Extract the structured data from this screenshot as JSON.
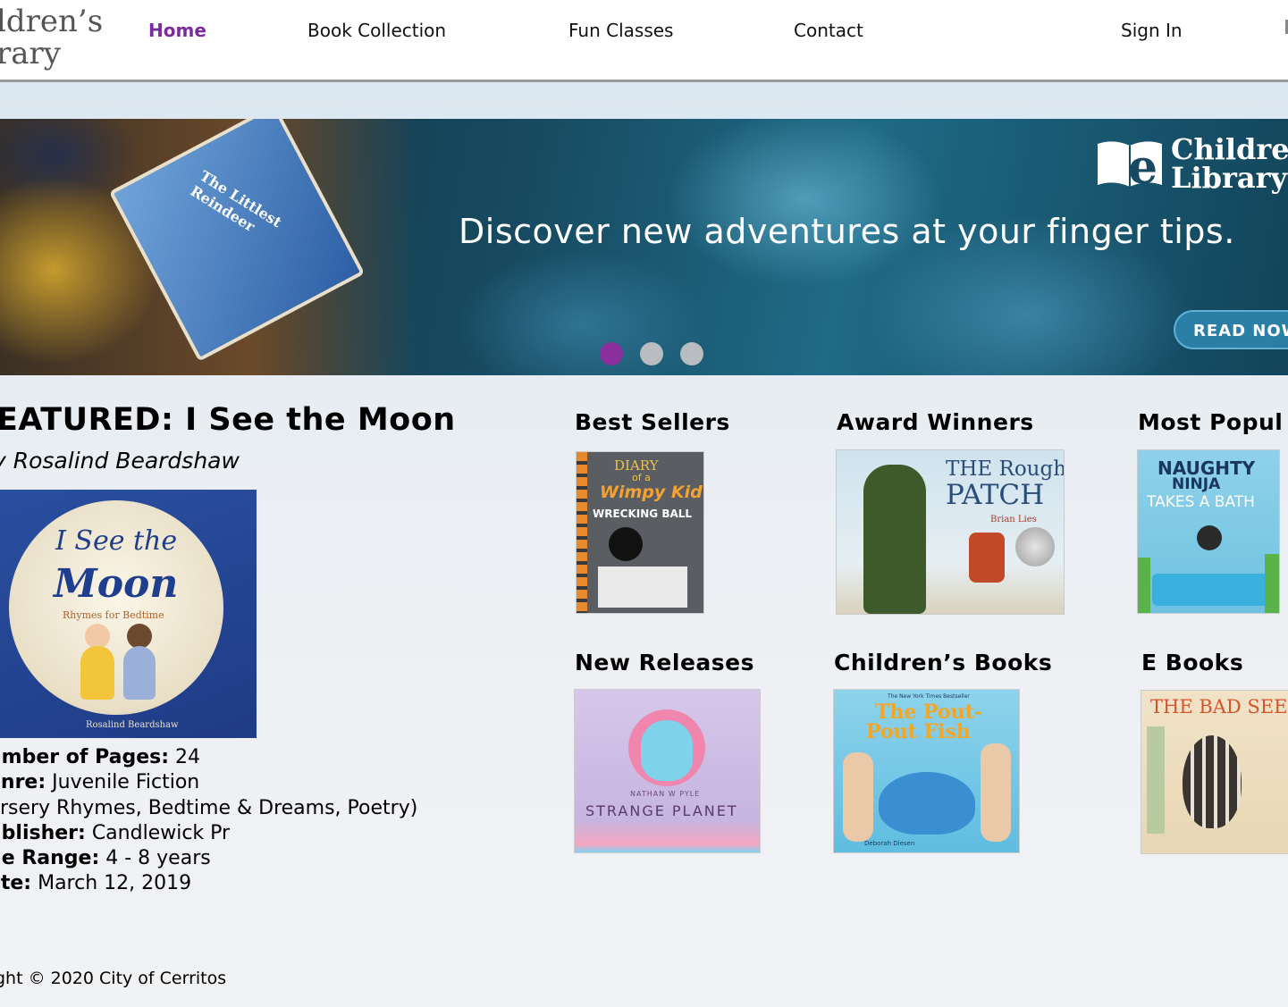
{
  "header": {
    "logo_line1": "ldren’s",
    "logo_line2": "rary",
    "nav": {
      "home": "Home",
      "collection": "Book Collection",
      "classes": "Fun Classes",
      "contact": "Contact",
      "signin": "Sign In"
    }
  },
  "hero": {
    "tagline": "Discover new adventures at your finger tips.",
    "brand_line1": "Childre",
    "brand_line2": "Library",
    "read_now": "READ NOW",
    "book_title": "The Littlest Reindeer",
    "active_slide": 1,
    "slide_count": 3
  },
  "featured": {
    "title": "EATURED: I See the Moon",
    "author": "y Rosalind Beardshaw",
    "cover": {
      "title_line1": "I See the",
      "title_line2": "Moon",
      "subtitle": "Rhymes for Bedtime",
      "author": "Rosalind Beardshaw"
    },
    "details": {
      "pages_label": "umber of Pages:",
      "pages_value": " 24",
      "genre_label": "enre:",
      "genre_value": " Juvenile Fiction",
      "genre_cont": "ursery Rhymes, Bedtime & Dreams, Poetry)",
      "publisher_label": "ublisher:",
      "publisher_value": " Candlewick Pr",
      "age_label": "ge Range:",
      "age_value": " 4 - 8 years",
      "date_label": "ate:",
      "date_value": " March 12, 2019"
    }
  },
  "categories": {
    "best_sellers": {
      "title": "Best Sellers",
      "cover_line1": "DIARY",
      "cover_line2": "of a",
      "cover_line3": "Wimpy Kid",
      "cover_line4": "WRECKING BALL"
    },
    "award_winners": {
      "title": "Award Winners",
      "cover_line1": "THE Rough",
      "cover_line2": "PATCH",
      "cover_line3": "Brian Lies"
    },
    "most_popular": {
      "title": "Most Popul",
      "cover_line1": "NAUGHTY",
      "cover_line2": "NINJA",
      "cover_line3": "TAKES A BATH"
    },
    "new_releases": {
      "title": "New Releases",
      "cover_line1": "NATHAN W PYLE",
      "cover_line2": "STRANGE PLANET"
    },
    "childrens_books": {
      "title": "Children’s Books",
      "cover_line1": "The New York Times Bestseller",
      "cover_line2": "The Pout-",
      "cover_line3": "Pout Fish",
      "cover_line4": "Deborah Diesen"
    },
    "e_books": {
      "title": "E Books",
      "cover_line1": "THE BAD SEED"
    }
  },
  "footer": {
    "copyright": "ght © 2020 City of Cerritos"
  },
  "colors": {
    "accent": "#7a2b9e",
    "button": "#2b7ea6",
    "hero_dark": "#174a60"
  }
}
